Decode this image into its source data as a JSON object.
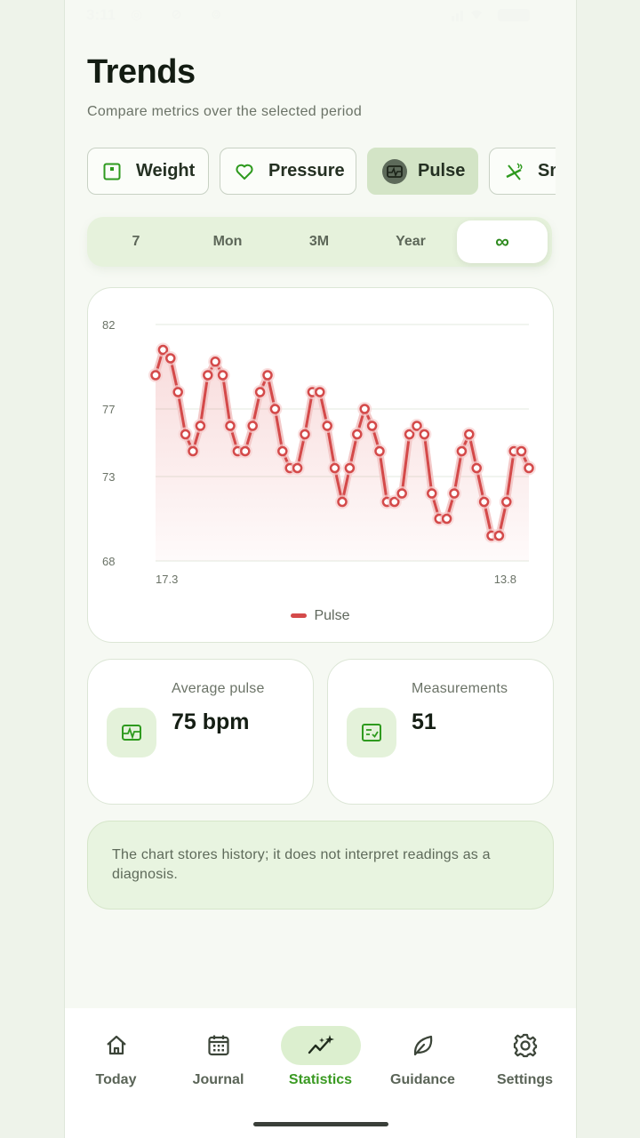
{
  "status_bar": {
    "time": "3:11"
  },
  "header": {
    "title": "Trends",
    "subtitle": "Compare metrics over the selected period"
  },
  "metric_tabs": [
    {
      "label": "Weight",
      "icon": "scale-icon",
      "active": false
    },
    {
      "label": "Pressure",
      "icon": "heart-icon",
      "active": false
    },
    {
      "label": "Pulse",
      "icon": "ecg-icon",
      "active": true
    },
    {
      "label": "Smoking",
      "icon": "smoking-icon",
      "active": false
    }
  ],
  "period": {
    "options": [
      "7",
      "Mon",
      "3M",
      "Year",
      "∞"
    ],
    "selected": "∞"
  },
  "chart_data": {
    "type": "line",
    "series": [
      {
        "name": "Pulse",
        "color": "#d44a4a",
        "values": [
          79,
          80.5,
          80,
          78,
          75.5,
          74.5,
          76,
          79,
          79.8,
          79,
          76,
          74.5,
          74.5,
          76,
          78,
          79,
          77,
          74.5,
          73.5,
          73.5,
          75.5,
          78,
          78,
          76,
          73.5,
          71.5,
          73.5,
          75.5,
          77,
          76,
          74.5,
          71.5,
          71.5,
          72,
          75.5,
          76,
          75.5,
          72,
          70.5,
          70.5,
          72,
          74.5,
          75.5,
          73.5,
          71.5,
          69.5,
          69.5,
          71.5,
          74.5,
          74.5,
          73.5
        ]
      }
    ],
    "x_tick_labels": [
      "17.3",
      "13.8"
    ],
    "y_ticks": [
      68,
      73,
      77,
      82
    ],
    "ylim": [
      68,
      82
    ],
    "grid": true,
    "legend": "bottom-center"
  },
  "stats": [
    {
      "label": "Average pulse",
      "value": "75 bpm",
      "icon": "ecg-icon"
    },
    {
      "label": "Measurements",
      "value": "51",
      "icon": "checklist-icon"
    }
  ],
  "note": "The chart stores history; it does not interpret readings as a diagnosis.",
  "nav": [
    {
      "label": "Today",
      "icon": "home-icon",
      "active": false
    },
    {
      "label": "Journal",
      "icon": "calendar-icon",
      "active": false
    },
    {
      "label": "Statistics",
      "icon": "trend-sparkle-icon",
      "active": true
    },
    {
      "label": "Guidance",
      "icon": "leaf-icon",
      "active": false
    },
    {
      "label": "Settings",
      "icon": "gear-icon",
      "active": false
    }
  ]
}
